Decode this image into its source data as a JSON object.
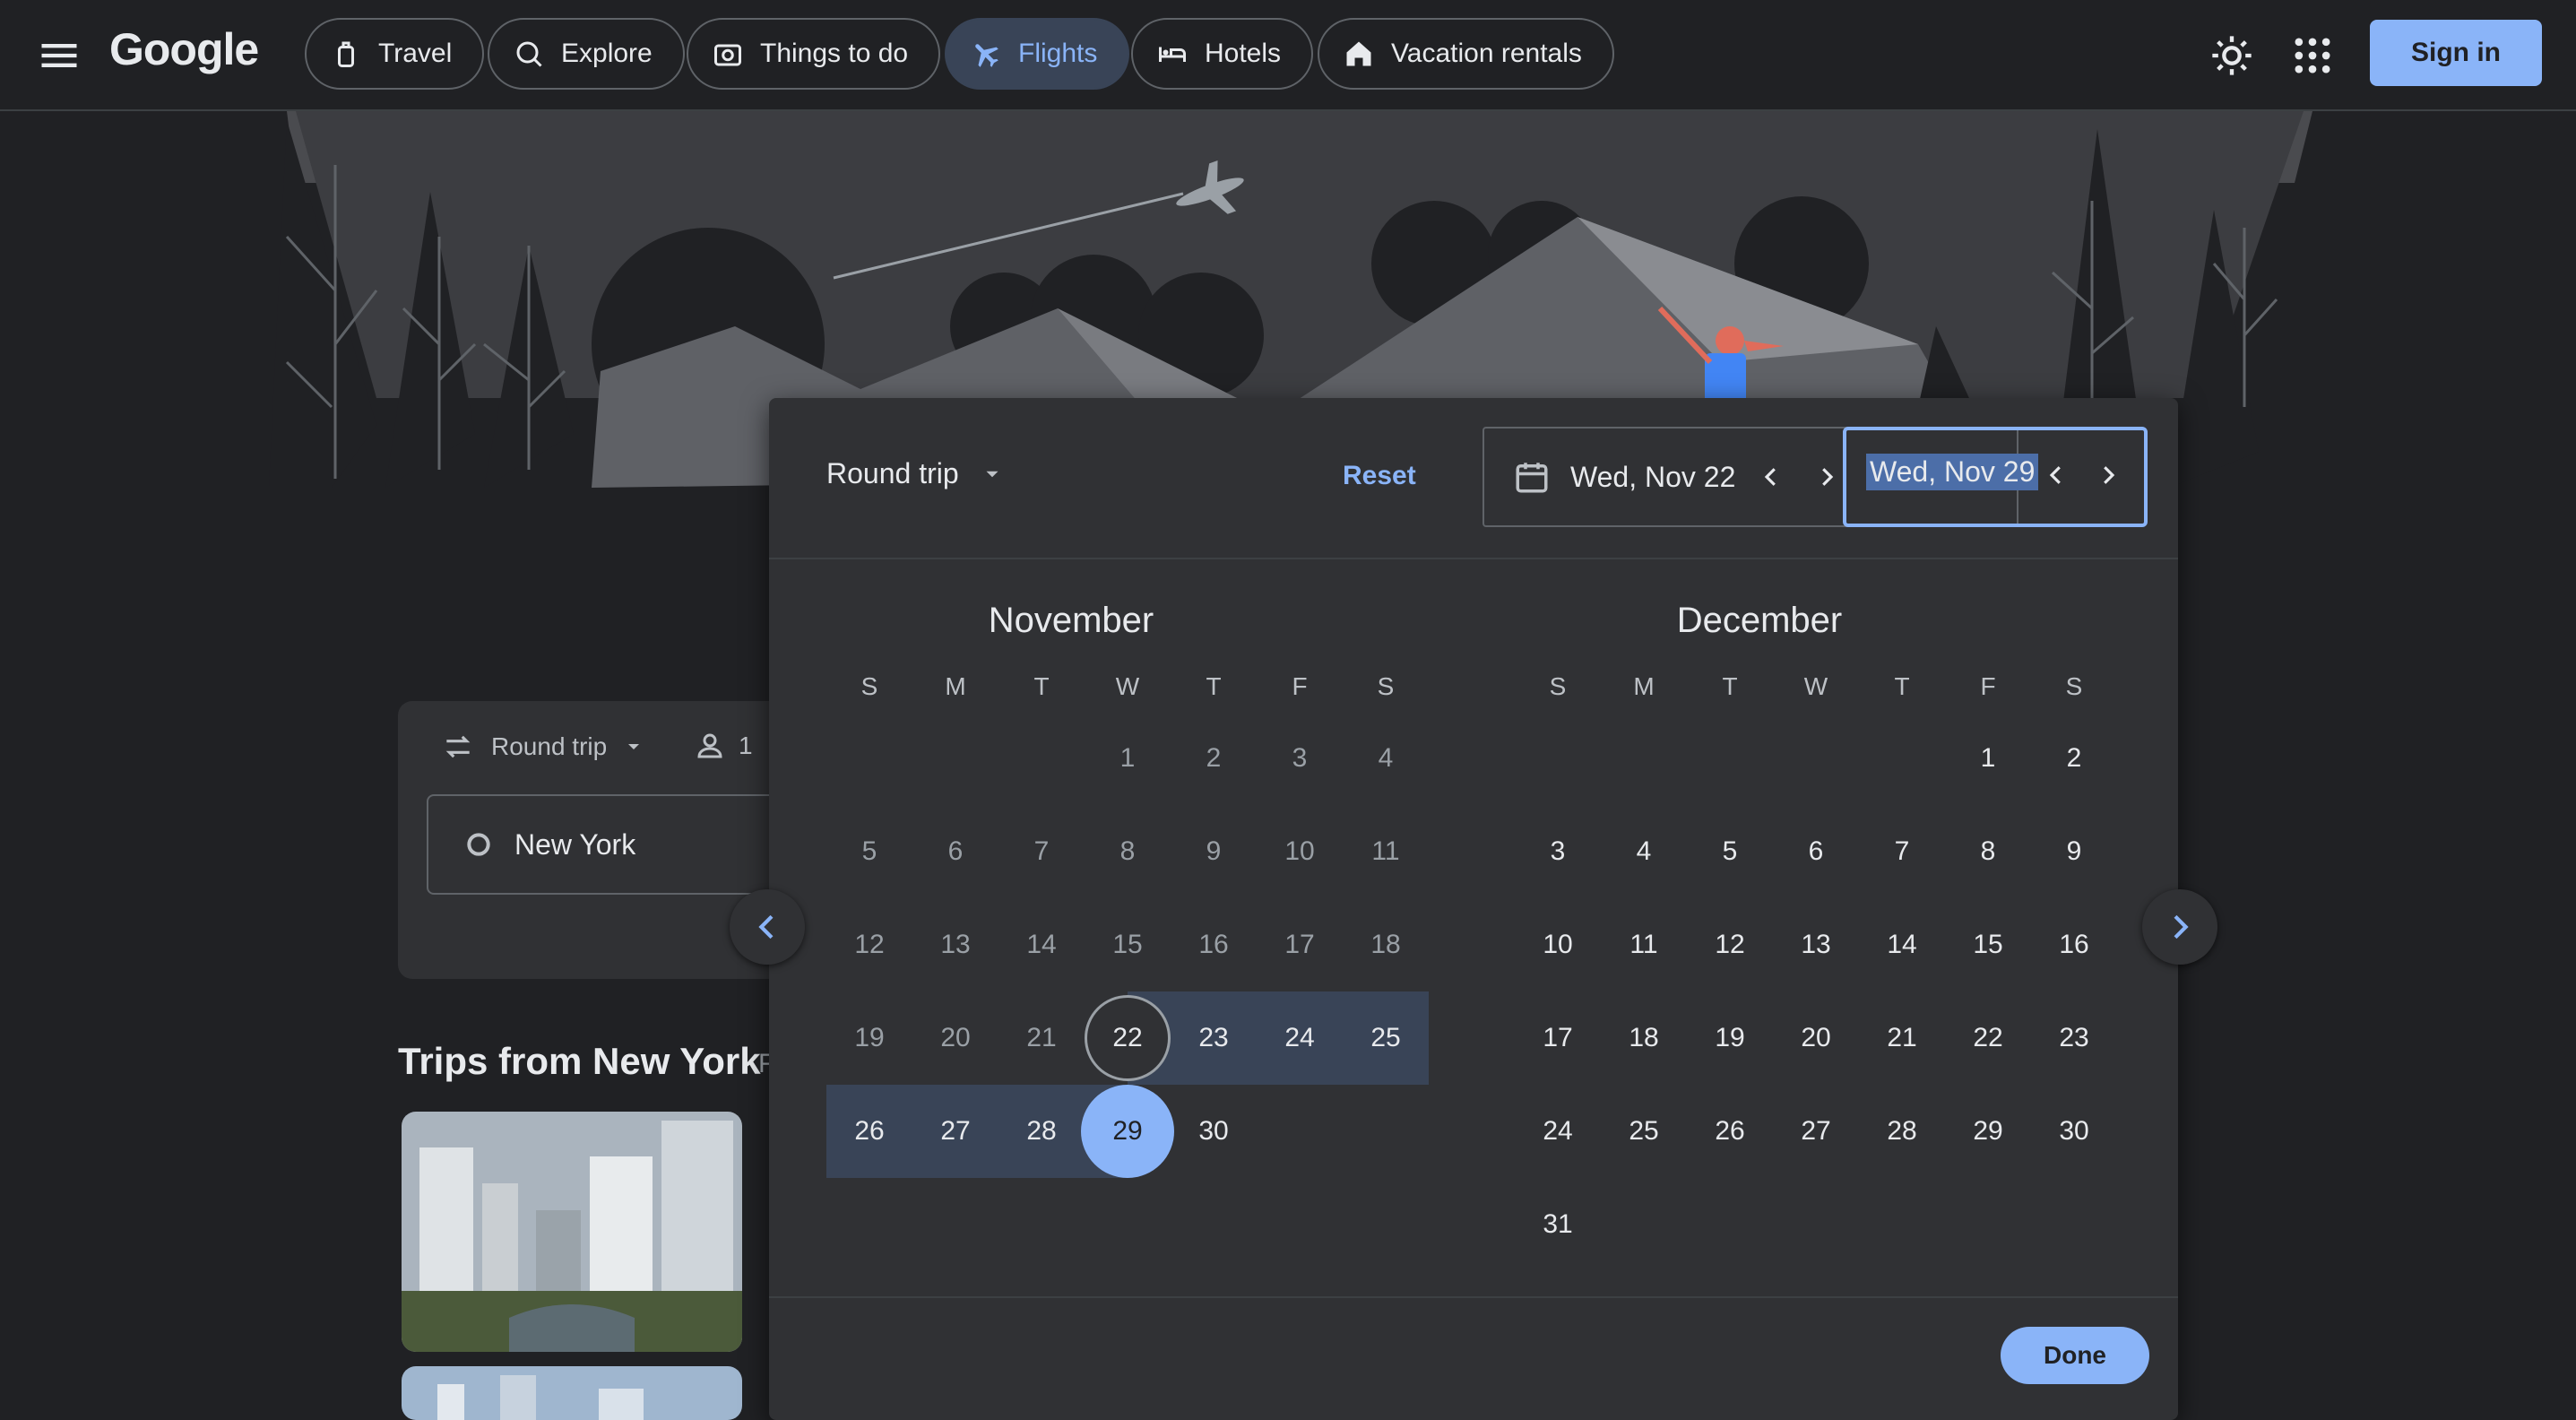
{
  "header": {
    "logo": "Google",
    "nav": [
      {
        "label": "Travel",
        "icon": "luggage-icon"
      },
      {
        "label": "Explore",
        "icon": "explore-icon"
      },
      {
        "label": "Things to do",
        "icon": "camera-icon"
      },
      {
        "label": "Flights",
        "icon": "airplane-icon",
        "active": true
      },
      {
        "label": "Hotels",
        "icon": "bed-icon"
      },
      {
        "label": "Vacation rentals",
        "icon": "house-icon"
      }
    ],
    "sign_in": "Sign in"
  },
  "search": {
    "trip_type": "Round trip",
    "passengers": "1",
    "origin": "New York"
  },
  "trips": {
    "title": "Trips from New York",
    "extra": "F"
  },
  "picker": {
    "trip_type": "Round trip",
    "reset": "Reset",
    "depart": "Wed, Nov 22",
    "return": "Wed, Nov 29",
    "done": "Done",
    "weekdays": [
      "S",
      "M",
      "T",
      "W",
      "T",
      "F",
      "S"
    ],
    "months": [
      {
        "name": "November",
        "offset": 3,
        "days": 30
      },
      {
        "name": "December",
        "offset": 5,
        "days": 31
      }
    ],
    "depart_day": 22,
    "return_day": 29,
    "today_cutoff_day": 22
  },
  "colors": {
    "accent": "#8ab4f8",
    "range": "#394457",
    "background": "#202124",
    "surface": "#303134"
  }
}
